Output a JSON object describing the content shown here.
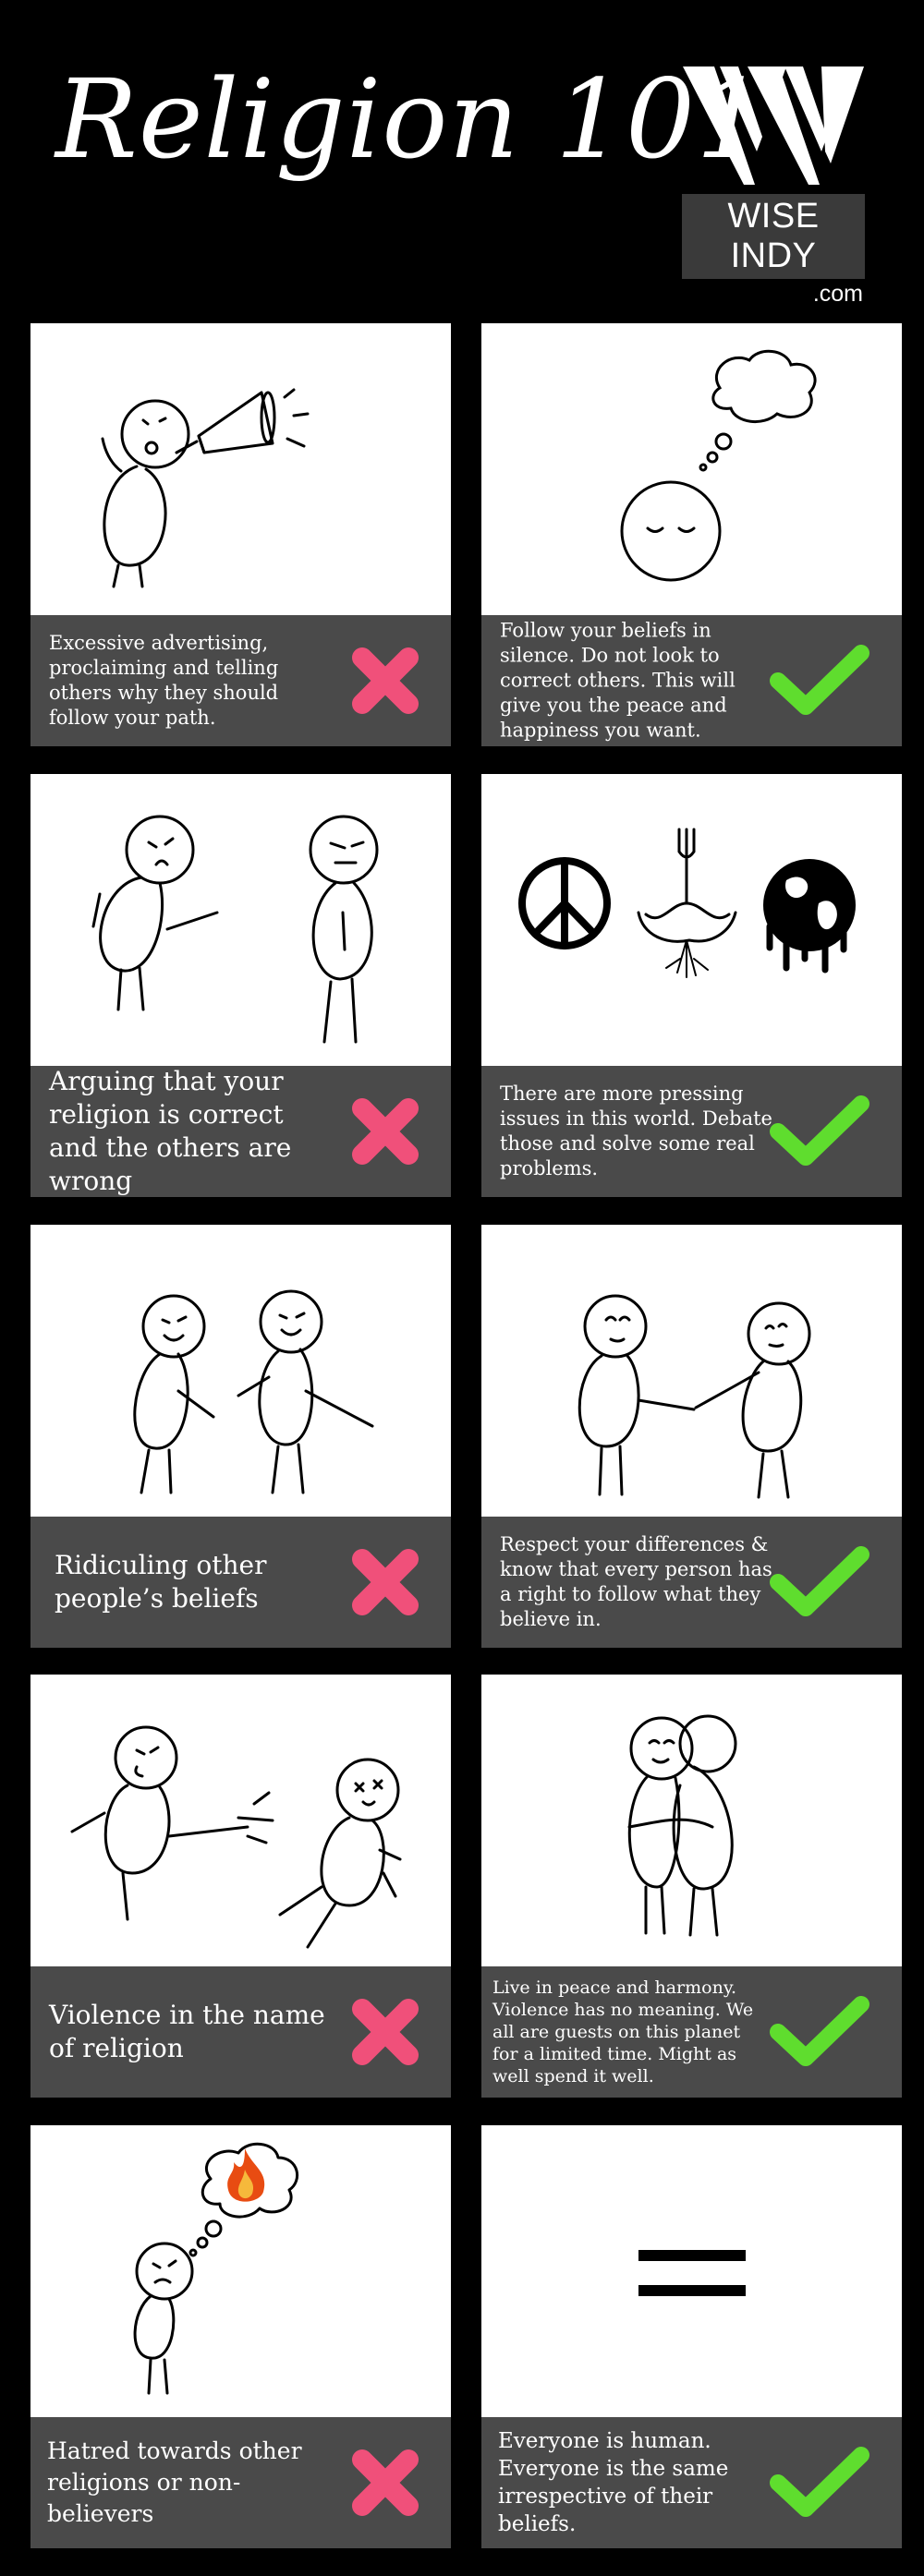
{
  "header": {
    "title": "Religion 101",
    "logo_text": "WISE INDY",
    "logo_suffix": ".com"
  },
  "colors": {
    "background": "#000000",
    "caption_bg": "#4a4a4a",
    "cross": "#f0507a",
    "check": "#5fdd2e"
  },
  "rows": [
    {
      "left": {
        "caption": "Excessive advertising, proclaiming and telling others why they should follow your path.",
        "mark": "cross-icon"
      },
      "right": {
        "caption": "Follow your beliefs in silence. Do not look to correct others. This will give you the peace and happiness you want.",
        "mark": "check-icon"
      }
    },
    {
      "left": {
        "caption": "Arguing that your religion is correct and the others are wrong",
        "mark": "cross-icon"
      },
      "right": {
        "caption": "There are more pressing issues in this world. Debate those and solve some real problems.",
        "mark": "check-icon"
      }
    },
    {
      "left": {
        "caption": "Ridiculing other people’s beliefs",
        "mark": "cross-icon"
      },
      "right": {
        "caption": "Respect your differences & know that every person has a right to follow what they believe in.",
        "mark": "check-icon"
      }
    },
    {
      "left": {
        "caption": "Violence in the name of religion",
        "mark": "cross-icon"
      },
      "right": {
        "caption": "Live in peace and harmony. Violence has no meaning. We all are guests on this planet for a limited time. Might as well spend it well.",
        "mark": "check-icon"
      }
    },
    {
      "left": {
        "caption": "Hatred towards other religions or non-believers",
        "mark": "cross-icon"
      },
      "right": {
        "caption": "Everyone is human. Everyone is the same irrespective of their beliefs.",
        "mark": "check-icon"
      }
    }
  ]
}
